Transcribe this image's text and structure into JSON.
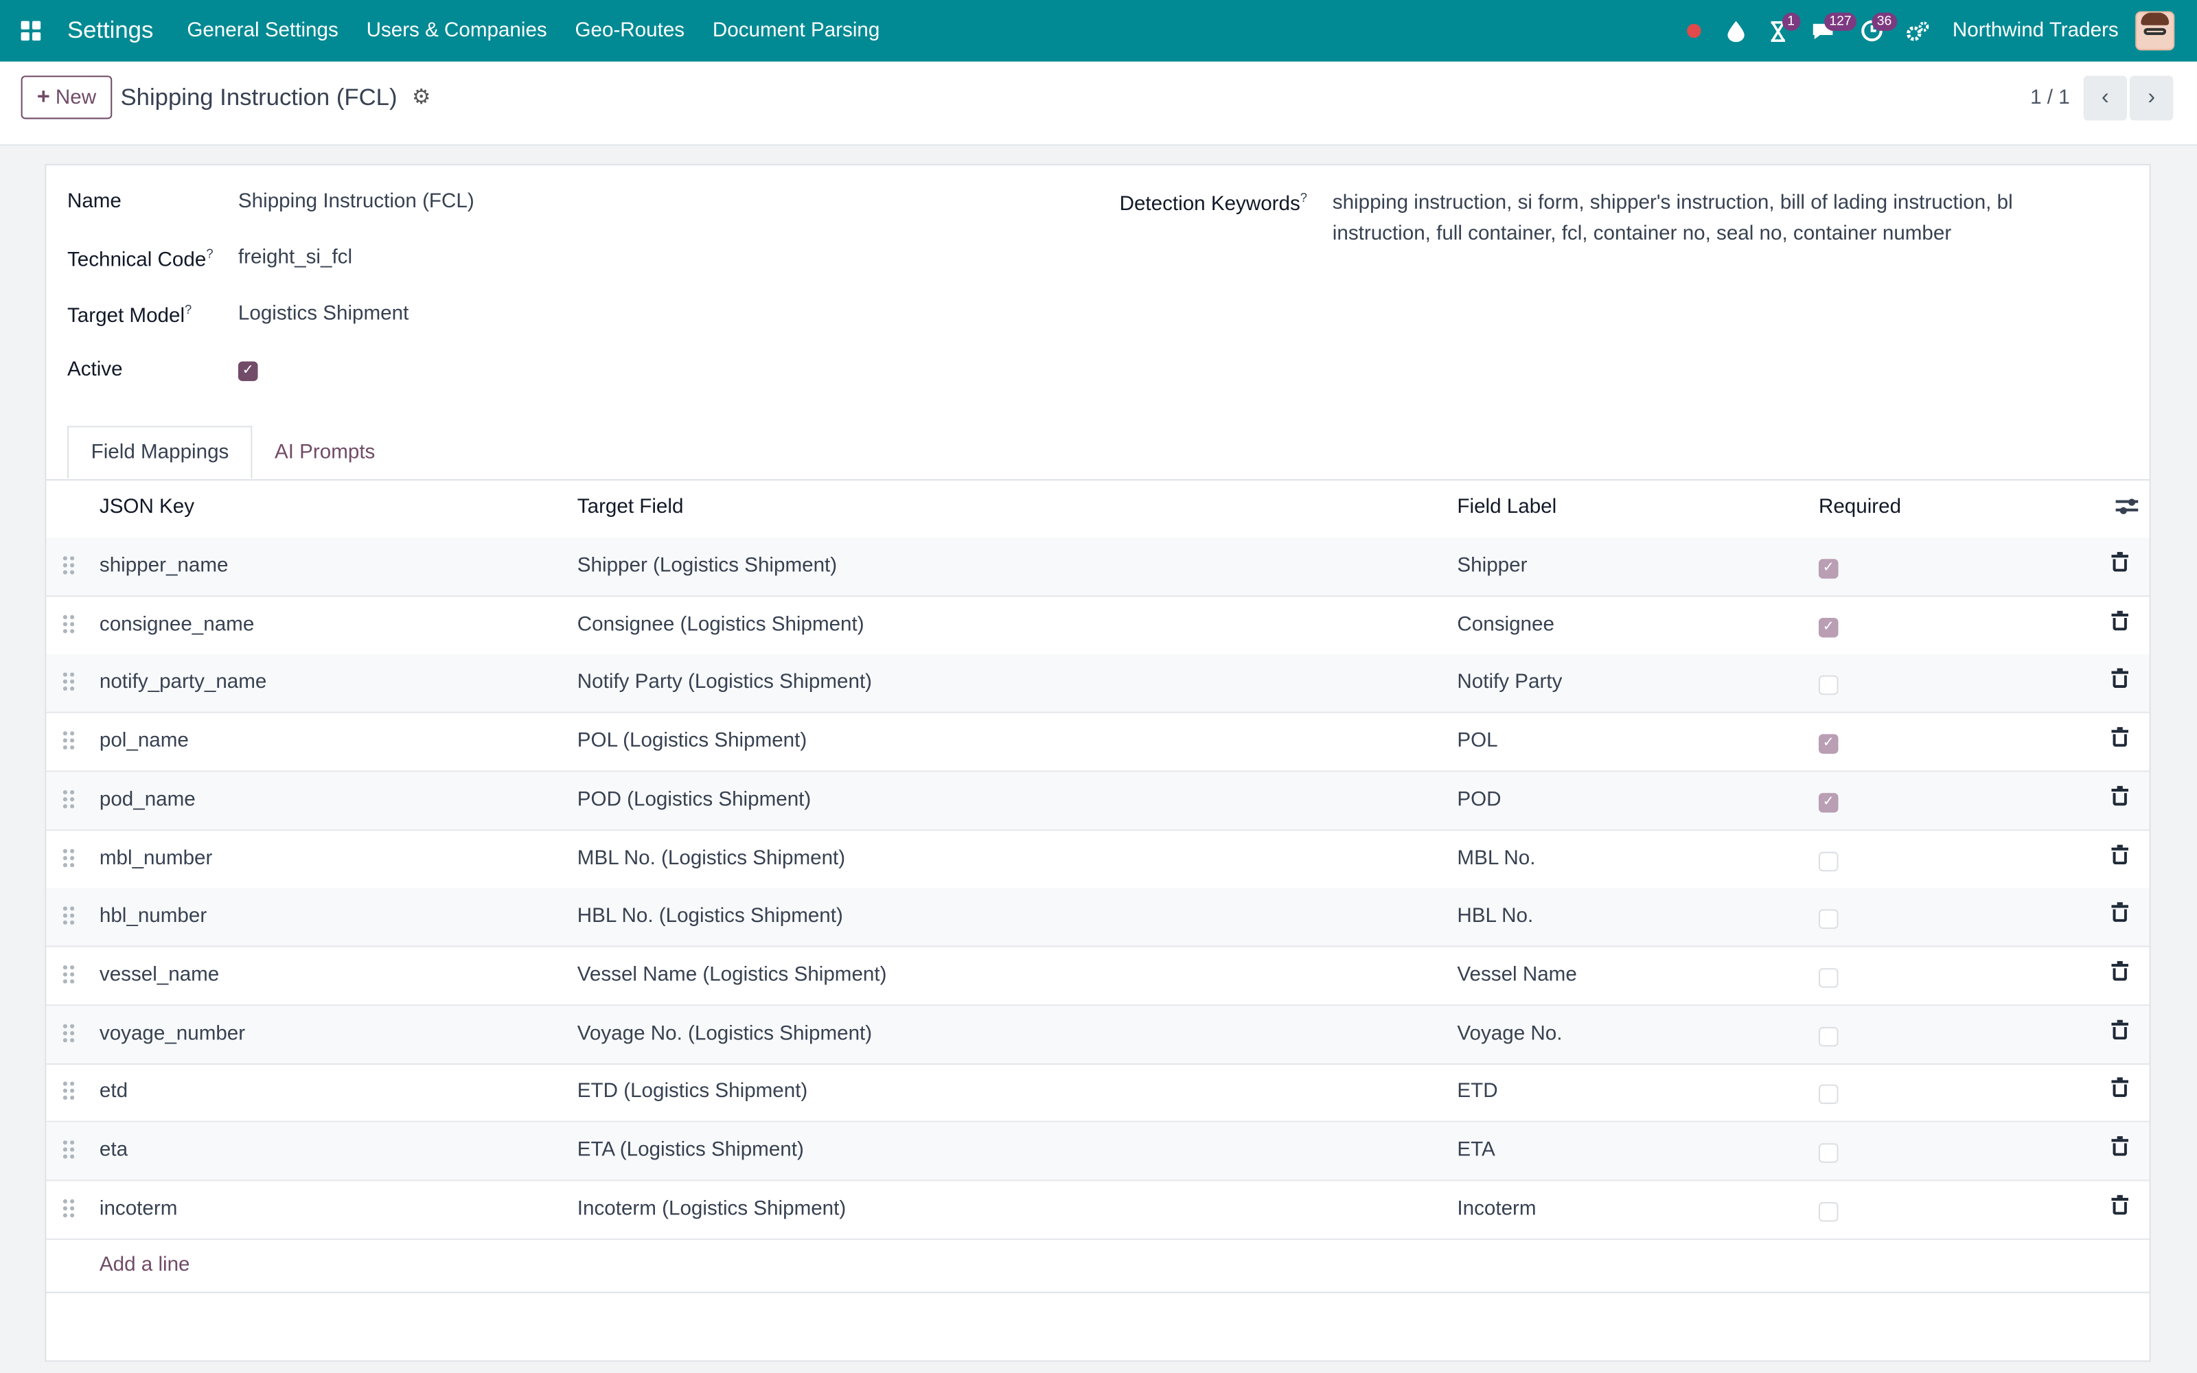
{
  "navbar": {
    "brand": "Settings",
    "menu": [
      "General Settings",
      "Users & Companies",
      "Geo-Routes",
      "Document Parsing"
    ],
    "badges": {
      "activity": "1",
      "messages": "127",
      "clock": "36"
    },
    "company": "Northwind Traders",
    "accent": "#018a94"
  },
  "control": {
    "new_label": "New",
    "title": "Shipping Instruction (FCL)",
    "pager": "1 / 1"
  },
  "form": {
    "name_label": "Name",
    "name_value": "Shipping Instruction (FCL)",
    "code_label": "Technical Code",
    "code_value": "freight_si_fcl",
    "model_label": "Target Model",
    "model_value": "Logistics Shipment",
    "active_label": "Active",
    "active_value": true,
    "keywords_label": "Detection Keywords",
    "keywords_value": "shipping instruction, si form, shipper's instruction, bill of lading instruction, bl instruction, full container, fcl, container no, seal no, container number",
    "tooltip_mark": "?"
  },
  "tabs": [
    "Field Mappings",
    "AI Prompts"
  ],
  "table": {
    "headers": [
      "JSON Key",
      "Target Field",
      "Field Label",
      "Required"
    ],
    "rows": [
      {
        "key": "shipper_name",
        "target": "Shipper (Logistics Shipment)",
        "label": "Shipper",
        "required": true
      },
      {
        "key": "consignee_name",
        "target": "Consignee (Logistics Shipment)",
        "label": "Consignee",
        "required": true
      },
      {
        "key": "notify_party_name",
        "target": "Notify Party (Logistics Shipment)",
        "label": "Notify Party",
        "required": false
      },
      {
        "key": "pol_name",
        "target": "POL (Logistics Shipment)",
        "label": "POL",
        "required": true
      },
      {
        "key": "pod_name",
        "target": "POD (Logistics Shipment)",
        "label": "POD",
        "required": true
      },
      {
        "key": "mbl_number",
        "target": "MBL No. (Logistics Shipment)",
        "label": "MBL No.",
        "required": false
      },
      {
        "key": "hbl_number",
        "target": "HBL No. (Logistics Shipment)",
        "label": "HBL No.",
        "required": false
      },
      {
        "key": "vessel_name",
        "target": "Vessel Name (Logistics Shipment)",
        "label": "Vessel Name",
        "required": false
      },
      {
        "key": "voyage_number",
        "target": "Voyage No. (Logistics Shipment)",
        "label": "Voyage No.",
        "required": false
      },
      {
        "key": "etd",
        "target": "ETD (Logistics Shipment)",
        "label": "ETD",
        "required": false
      },
      {
        "key": "eta",
        "target": "ETA (Logistics Shipment)",
        "label": "ETA",
        "required": false
      },
      {
        "key": "incoterm",
        "target": "Incoterm (Logistics Shipment)",
        "label": "Incoterm",
        "required": false
      }
    ],
    "add_line": "Add a line"
  }
}
